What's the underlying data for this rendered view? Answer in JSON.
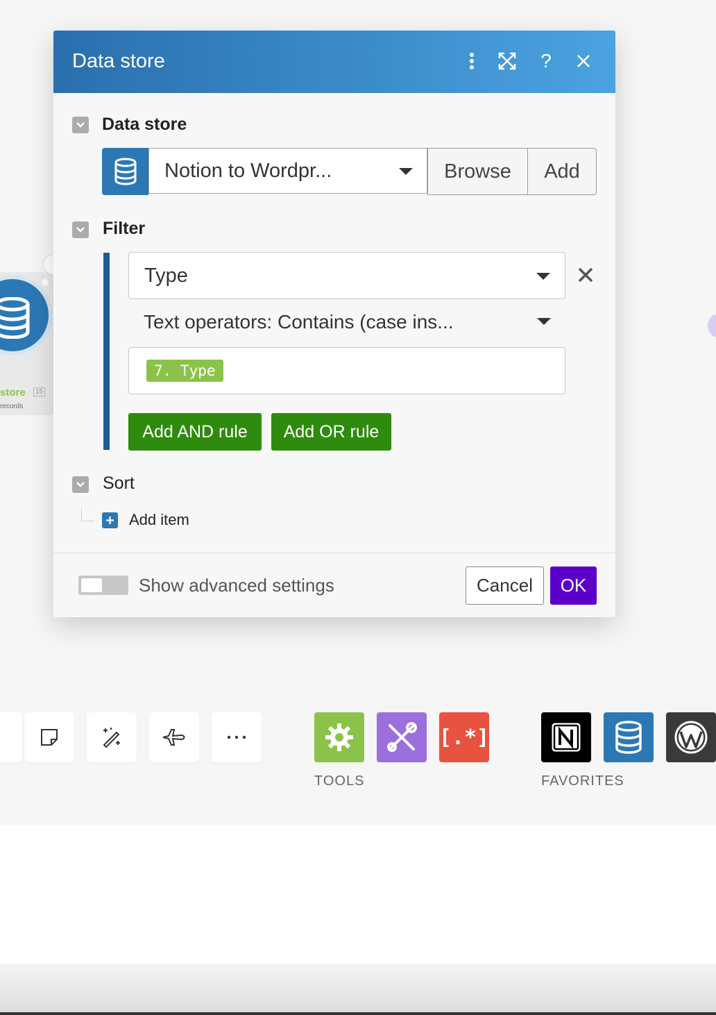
{
  "dialog": {
    "title": "Data store",
    "sections": {
      "data_store": {
        "label": "Data store",
        "selected_value": "Notion to Wordpr...",
        "browse_label": "Browse",
        "add_label": "Add"
      },
      "filter": {
        "label": "Filter",
        "field_value": "Type",
        "operator_value": "Text operators: Contains (case ins...",
        "value_tag": "7. Type",
        "add_and_label": "Add AND rule",
        "add_or_label": "Add OR rule"
      },
      "sort": {
        "label": "Sort",
        "add_item_label": "Add item"
      }
    },
    "footer": {
      "advanced_label": "Show advanced settings",
      "cancel_label": "Cancel",
      "ok_label": "OK"
    }
  },
  "node": {
    "label": "store",
    "badge": "15",
    "sub": "records"
  },
  "toolbar": {
    "tools_caption": "TOOLS",
    "favorites_caption": "FAVORITES",
    "ok_color": "#5c00c9",
    "header_gradient": [
      "#2a6fae",
      "#4ba3e0"
    ],
    "tools_colors": [
      "#8bc34a",
      "#9b6fdc",
      "#e8523f"
    ],
    "favorites": [
      "notion-icon",
      "data-store-icon",
      "wordpress-icon"
    ]
  }
}
